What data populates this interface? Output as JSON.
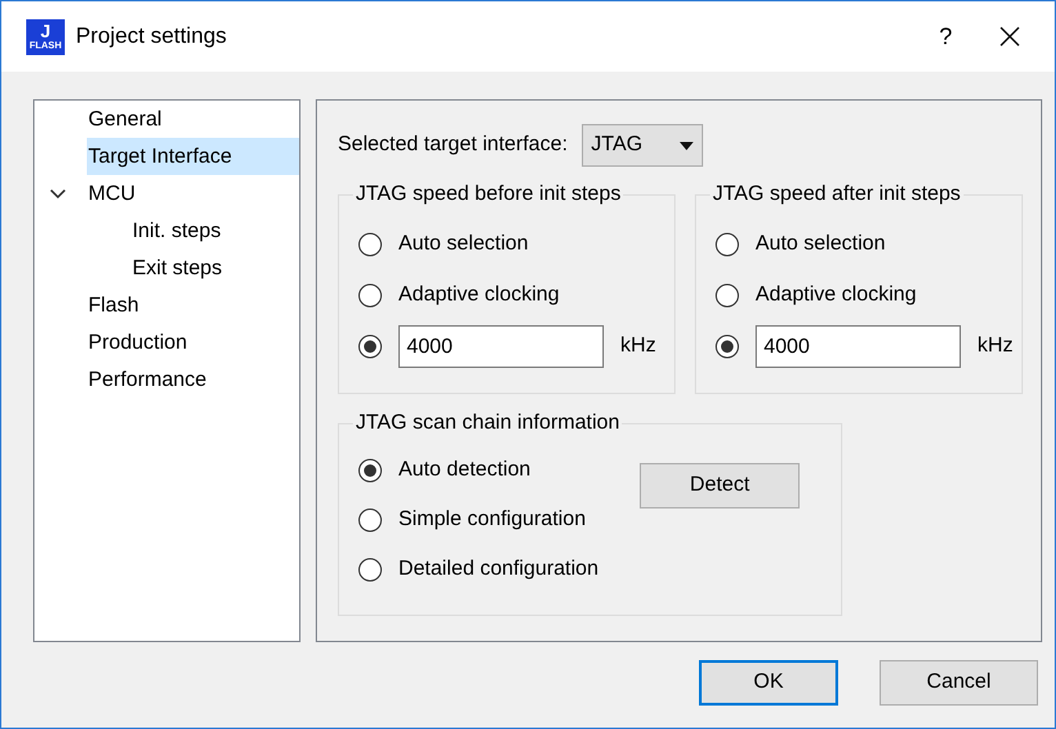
{
  "window": {
    "title": "Project settings",
    "icon": {
      "letter": "J",
      "word": "FLASH"
    },
    "help": "?"
  },
  "sidebar": {
    "items": [
      {
        "label": "General",
        "selected": false
      },
      {
        "label": "Target Interface",
        "selected": true
      },
      {
        "label": "MCU",
        "selected": false,
        "expanded": true,
        "children": [
          {
            "label": "Init. steps",
            "selected": false
          },
          {
            "label": "Exit steps",
            "selected": false
          }
        ]
      },
      {
        "label": "Flash",
        "selected": false
      },
      {
        "label": "Production",
        "selected": false
      },
      {
        "label": "Performance",
        "selected": false
      }
    ]
  },
  "target": {
    "label": "Selected target interface:",
    "value": "JTAG"
  },
  "speed_groups": [
    {
      "title": "JTAG speed before init steps",
      "options": [
        {
          "kind": "radio",
          "label": "Auto selection",
          "selected": false
        },
        {
          "kind": "radio",
          "label": "Adaptive clocking",
          "selected": false
        },
        {
          "kind": "field",
          "value": "4000",
          "unit": "kHz",
          "selected": true
        }
      ]
    },
    {
      "title": "JTAG speed after init steps",
      "options": [
        {
          "kind": "radio",
          "label": "Auto selection",
          "selected": false
        },
        {
          "kind": "radio",
          "label": "Adaptive clocking",
          "selected": false
        },
        {
          "kind": "field",
          "value": "4000",
          "unit": "kHz",
          "selected": true
        }
      ]
    }
  ],
  "scan_chain": {
    "title": "JTAG scan chain information",
    "options": [
      {
        "label": "Auto detection",
        "selected": true
      },
      {
        "label": "Simple configuration",
        "selected": false
      },
      {
        "label": "Detailed configuration",
        "selected": false
      }
    ],
    "button": "Detect"
  },
  "buttons": [
    {
      "label": "OK",
      "default": true
    },
    {
      "label": "Cancel",
      "default": false
    }
  ]
}
